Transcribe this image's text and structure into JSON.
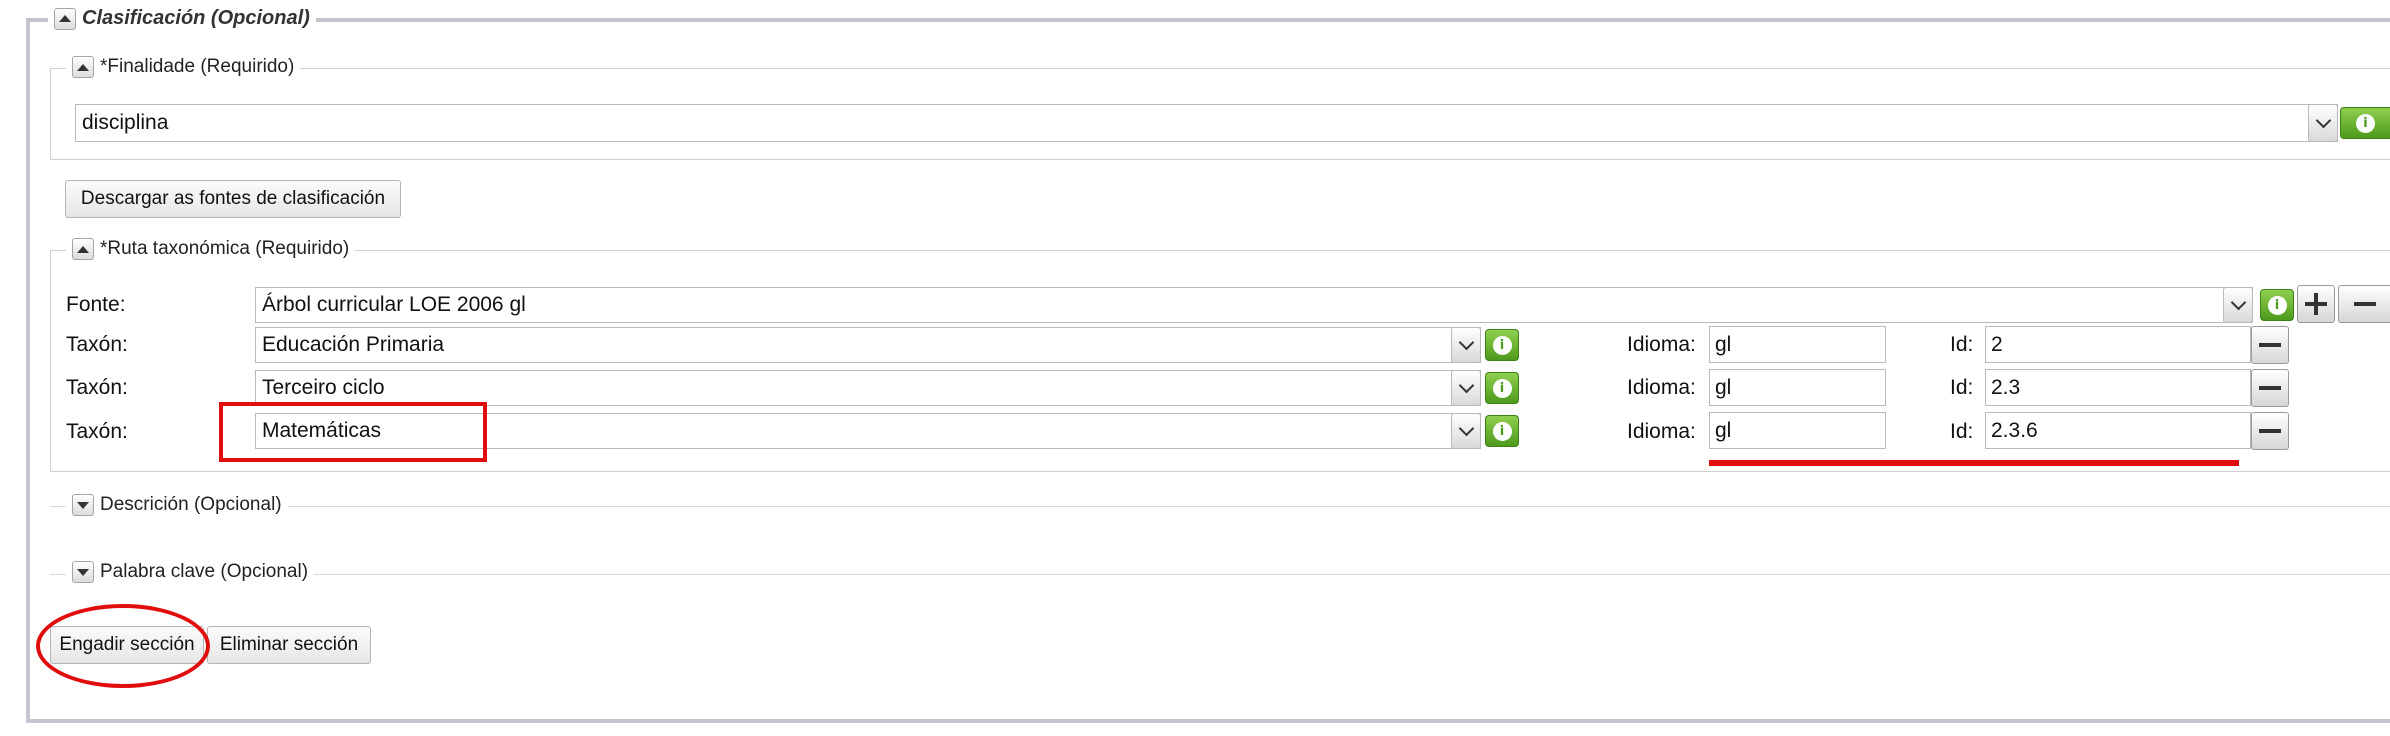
{
  "clasificacion": {
    "legend": "Clasificación (Opcional)",
    "finalidade": {
      "legend": "*Finalidade (Requirido)",
      "value": "disciplina"
    },
    "download_button": "Descargar as fontes de clasificación",
    "ruta": {
      "legend": "*Ruta taxonómica (Requirido)",
      "fonte_label": "Fonte:",
      "fonte_value": "Árbol curricular LOE 2006 gl",
      "taxon_rows": [
        {
          "label": "Taxón:",
          "value": "Educación Primaria",
          "idioma_label": "Idioma:",
          "idioma": "gl",
          "id_label": "Id:",
          "id": "2"
        },
        {
          "label": "Taxón:",
          "value": "Terceiro ciclo",
          "idioma_label": "Idioma:",
          "idioma": "gl",
          "id_label": "Id:",
          "id": "2.3"
        },
        {
          "label": "Taxón:",
          "value": "Matemáticas",
          "idioma_label": "Idioma:",
          "idioma": "gl",
          "id_label": "Id:",
          "id": "2.3.6"
        }
      ]
    },
    "descricion": {
      "legend": "Descrición (Opcional)"
    },
    "palabra_clave": {
      "legend": "Palabra clave (Opcional)"
    },
    "add_section_button": "Engadir sección",
    "remove_section_button": "Eliminar sección"
  },
  "colors": {
    "annotation_red": "#e10c0c",
    "info_green": "#5aa62a",
    "frame_grey": "#c4c6cf"
  },
  "icons": [
    "collapse-up-icon",
    "expand-down-icon",
    "chevron-down-icon",
    "info-icon",
    "plus-icon",
    "minus-icon"
  ]
}
